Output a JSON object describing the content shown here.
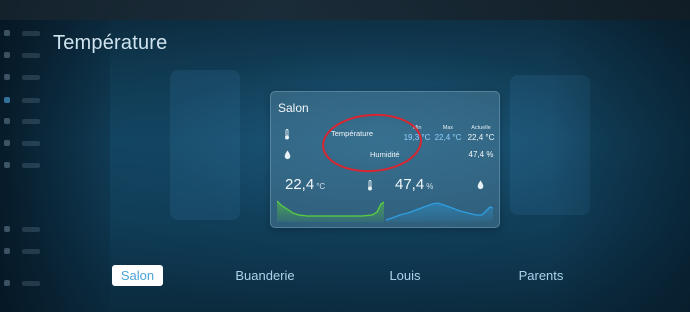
{
  "page": {
    "title": "Température"
  },
  "card": {
    "title": "Salon",
    "rows": [
      {
        "label": "Température",
        "icon": "thermometer-icon"
      },
      {
        "label": "Humidité",
        "icon": "water-drop-icon"
      }
    ],
    "columns": {
      "min": {
        "header": "Min",
        "temperature": "19,3 °C"
      },
      "max": {
        "header": "Max",
        "temperature": "22,4 °C"
      },
      "current": {
        "header": "Actuelle",
        "temperature": "22,4 °C",
        "humidity": "47,4 %"
      }
    },
    "graphs": {
      "temperature": {
        "value": "22,4",
        "unit": "°C",
        "icon": "thermometer-icon",
        "color": "#5ccf3f"
      },
      "humidity": {
        "value": "47,4",
        "unit": "%",
        "icon": "water-drop-icon",
        "color": "#2f9ee0"
      }
    }
  },
  "tabs": [
    {
      "label": "Salon",
      "active": true
    },
    {
      "label": "Buanderie",
      "active": false
    },
    {
      "label": "Louis",
      "active": false
    },
    {
      "label": "Parents",
      "active": false
    }
  ],
  "colors": {
    "accent": "#4aa3d8",
    "annotation": "#d8252f",
    "temperature_line": "#5ccf3f",
    "humidity_line": "#2f9ee0"
  }
}
